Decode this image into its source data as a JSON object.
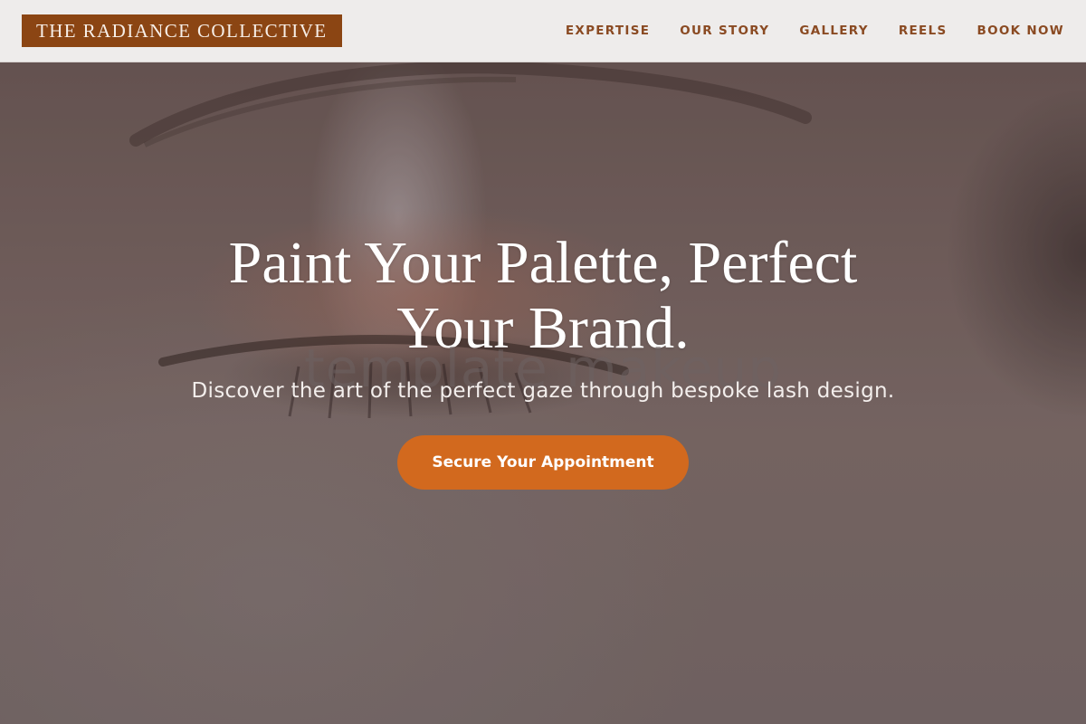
{
  "header": {
    "logo_text": "THE RADIANCE COLLECTIVE",
    "nav": [
      {
        "label": "EXPERTISE"
      },
      {
        "label": "OUR STORY"
      },
      {
        "label": "GALLERY"
      },
      {
        "label": "REELS"
      },
      {
        "label": "BOOK NOW"
      }
    ]
  },
  "hero": {
    "headline": "Paint Your Palette, Perfect Your Brand.",
    "watermark": "template makeup",
    "subheadline": "Discover the art of the perfect gaze through bespoke lash design.",
    "cta_label": "Secure Your Appointment"
  },
  "colors": {
    "brand": "#8b4513",
    "accent": "#d2691e",
    "nav_text": "#8a4a22",
    "header_bg": "#f4f2f1"
  }
}
